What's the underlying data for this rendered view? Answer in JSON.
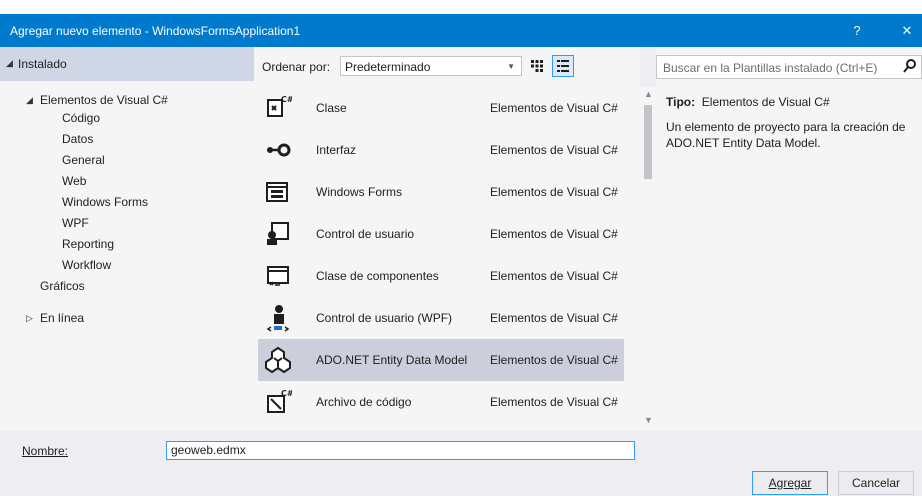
{
  "window": {
    "title": "Agregar nuevo elemento - WindowsFormsApplication1",
    "help_label": "?",
    "close_label": "✕"
  },
  "tree": {
    "header": "Instalado",
    "root": "Elementos de Visual C#",
    "children": [
      "Código",
      "Datos",
      "General",
      "Web",
      "Windows Forms",
      "WPF",
      "Reporting",
      "Workflow"
    ],
    "graficos": "Gráficos",
    "online": "En línea"
  },
  "toolbar": {
    "sort_label": "Ordenar por:",
    "sort_value": "Predeterminado"
  },
  "items": [
    {
      "name": "Clase",
      "category": "Elementos de Visual C#",
      "icon": "class-icon"
    },
    {
      "name": "Interfaz",
      "category": "Elementos de Visual C#",
      "icon": "interface-icon"
    },
    {
      "name": "Windows Forms",
      "category": "Elementos de Visual C#",
      "icon": "windows-form-icon"
    },
    {
      "name": "Control de usuario",
      "category": "Elementos de Visual C#",
      "icon": "user-control-icon"
    },
    {
      "name": "Clase de componentes",
      "category": "Elementos de Visual C#",
      "icon": "component-class-icon"
    },
    {
      "name": "Control de usuario (WPF)",
      "category": "Elementos de Visual C#",
      "icon": "wpf-user-control-icon"
    },
    {
      "name": "ADO.NET Entity Data Model",
      "category": "Elementos de Visual C#",
      "icon": "entity-data-model-icon",
      "selected": true
    },
    {
      "name": "Archivo de código",
      "category": "Elementos de Visual C#",
      "icon": "code-file-icon"
    }
  ],
  "search": {
    "placeholder": "Buscar en la Plantillas instalado (Ctrl+E)"
  },
  "info": {
    "tipo_label": "Tipo:",
    "tipo_value": "Elementos de Visual C#",
    "description": "Un elemento de proyecto para la creación de ADO.NET Entity Data Model."
  },
  "bottom": {
    "name_label": "Nombre:",
    "name_value": "geoweb.edmx",
    "add_label": "Agregar",
    "cancel_label": "Cancelar"
  },
  "colors": {
    "titlebar": "#007acc",
    "selection": "#cccedb",
    "tree_header": "#cfd6e5",
    "accent": "#3399ff"
  }
}
